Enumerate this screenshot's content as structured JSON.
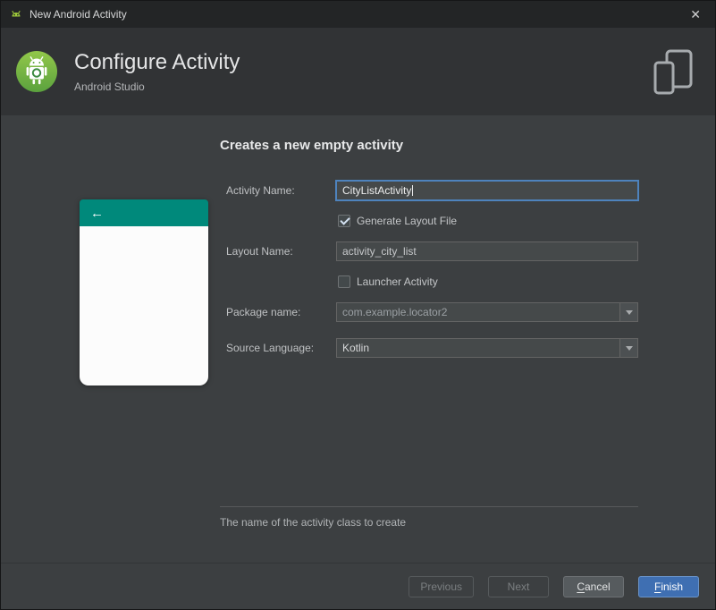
{
  "window": {
    "title": "New Android Activity",
    "close_glyph": "✕"
  },
  "banner": {
    "title": "Configure Activity",
    "subtitle": "Android Studio"
  },
  "preview": {
    "back_glyph": "←"
  },
  "form": {
    "heading": "Creates a new empty activity",
    "fields": {
      "activity_name": {
        "label": "Activity Name:",
        "value": "CityListActivity"
      },
      "layout_name": {
        "label": "Layout Name:",
        "value": "activity_city_list"
      },
      "package_name": {
        "label": "Package name:",
        "value": "com.example.locator2"
      },
      "source_language": {
        "label": "Source Language:",
        "value": "Kotlin"
      }
    },
    "checkboxes": {
      "generate_layout": {
        "label": "Generate Layout File",
        "checked": true
      },
      "launcher_activity": {
        "label": "Launcher Activity",
        "checked": false
      }
    },
    "hint": "The name of the activity class to create"
  },
  "buttons": {
    "previous": "Previous",
    "next": "Next",
    "cancel": "Cancel",
    "finish": "Finish"
  },
  "colors": {
    "appbar_teal": "#00897b",
    "focus_border": "#4e83bd",
    "finish_button": "#3f6fb2",
    "panel": "#3c3f41",
    "banner": "#313335"
  }
}
